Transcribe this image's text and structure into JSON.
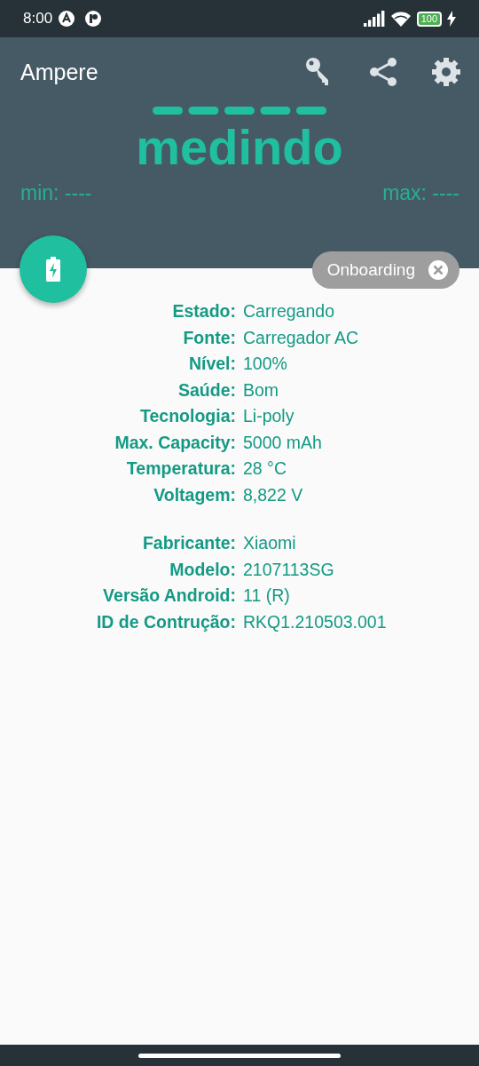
{
  "status_bar": {
    "time": "8:00",
    "battery": "100"
  },
  "app_bar": {
    "title": "Ampere"
  },
  "meter": {
    "status": "medindo",
    "min": "min: ----",
    "max": "max: ----"
  },
  "chip": {
    "label": "Onboarding"
  },
  "sections": [
    {
      "rows": [
        {
          "label": "Estado:",
          "value": "Carregando"
        },
        {
          "label": "Fonte:",
          "value": "Carregador AC"
        },
        {
          "label": "Nível:",
          "value": "100%"
        },
        {
          "label": "Saúde:",
          "value": "Bom"
        },
        {
          "label": "Tecnologia:",
          "value": "Li-poly"
        },
        {
          "label": "Max. Capacity:",
          "value": "5000 mAh"
        },
        {
          "label": "Temperatura:",
          "value": "28 °C"
        },
        {
          "label": "Voltagem:",
          "value": "8,822 V"
        }
      ]
    },
    {
      "rows": [
        {
          "label": "Fabricante:",
          "value": "Xiaomi"
        },
        {
          "label": "Modelo:",
          "value": "2107113SG"
        },
        {
          "label": "Versão Android:",
          "value": "11 (R)"
        },
        {
          "label": "ID de Contrução:",
          "value": "RKQ1.210503.001"
        }
      ]
    }
  ]
}
